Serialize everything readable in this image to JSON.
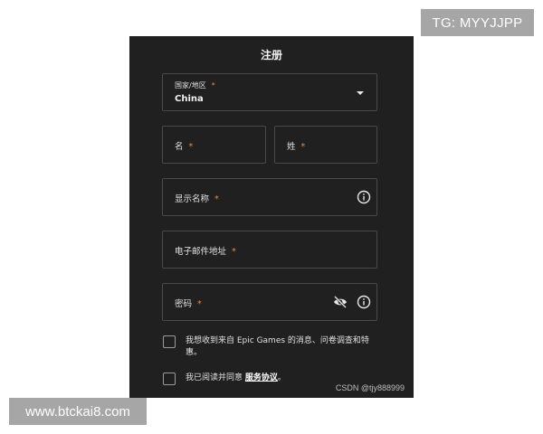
{
  "watermarks": {
    "top_right": "TG: MYYJJPP",
    "bottom_left": "www.btckai8.com",
    "csdn": "CSDN @tjy888999"
  },
  "form": {
    "title": "注册",
    "required_mark": "*",
    "country": {
      "label": "国家/地区",
      "value": "China"
    },
    "first_name": {
      "label": "名"
    },
    "last_name": {
      "label": "姓"
    },
    "display_name": {
      "label": "显示名称"
    },
    "email": {
      "label": "电子邮件地址"
    },
    "password": {
      "label": "密码"
    },
    "consent_marketing": {
      "text": "我想收到来自 Epic Games 的消息、问卷调查和特惠。",
      "checked": false
    },
    "consent_terms": {
      "prefix": "我已阅读并同意 ",
      "link": "服务协议",
      "suffix": "。",
      "checked": false
    }
  },
  "colors": {
    "panel_bg": "#202020",
    "field_border": "#4a4a4a",
    "required_star": "#f08a3a",
    "tag_bg": "#a6a6a6"
  },
  "icons": {
    "country_dropdown": "chevron-down-icon",
    "display_info": "info-icon",
    "password_visibility": "eye-off-icon",
    "password_info": "info-icon"
  }
}
